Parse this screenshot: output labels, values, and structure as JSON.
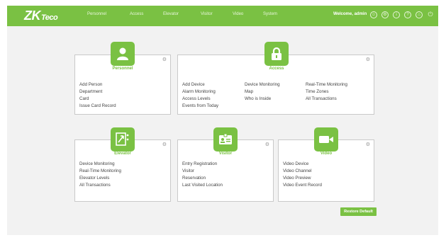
{
  "brand": {
    "zk": "ZK",
    "eco": "Teco"
  },
  "nav": [
    "Personnel",
    "Access",
    "Elevator",
    "Visitor",
    "Video",
    "System"
  ],
  "welcome": "Welcome, admin",
  "top_icons": [
    "user-icon",
    "settings-icon",
    "info-icon",
    "help-icon",
    "home-icon",
    "logout-icon"
  ],
  "cards": {
    "personnel": {
      "title": "Personnel",
      "links": [
        "Add Person",
        "Department",
        "Card",
        "Issue Card Record"
      ]
    },
    "access": {
      "title": "Access",
      "col1": [
        "Add Device",
        "Alarm Monitoring",
        "Access Levels",
        "Events from Today"
      ],
      "col2": [
        "Device Monitoring",
        "Map",
        "Who is Inside"
      ],
      "col3": [
        "Real-Time Monitoring",
        "Time Zones",
        "All Transactions"
      ]
    },
    "elevator": {
      "title": "Elevator",
      "links": [
        "Device Monitoring",
        "Real-Time Monitoring",
        "Elevator Levels",
        "All Transactions"
      ]
    },
    "visitor": {
      "title": "Visitor",
      "links": [
        "Entry Registration",
        "Visitor",
        "Reservation",
        "Last Visited Location"
      ]
    },
    "video": {
      "title": "Video",
      "links": [
        "Video Device",
        "Video Channel",
        "Video Preview",
        "Video Event Record"
      ]
    }
  },
  "restore_label": "Restore Default",
  "colors": {
    "accent": "#7ac143",
    "background": "#f2f2f2",
    "border": "#c9c9c9"
  }
}
